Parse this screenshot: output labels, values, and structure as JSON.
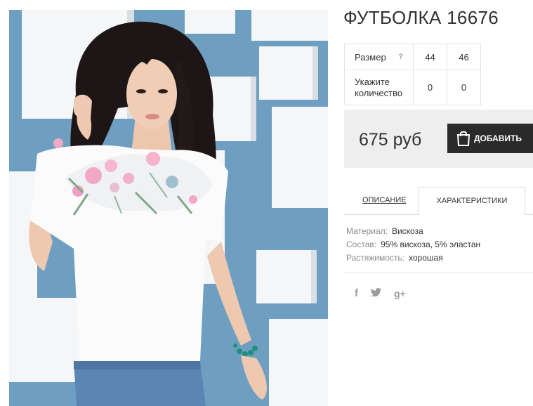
{
  "product": {
    "title": "ФУТБОЛКА 16676"
  },
  "size_table": {
    "size_label": "Размер",
    "help_icon": "?",
    "sizes": [
      "44",
      "46"
    ],
    "qty_label_line1": "Укажите",
    "qty_label_line2": "количество",
    "quantities": [
      "0",
      "0"
    ]
  },
  "purchase": {
    "price": "675 руб",
    "add_button_label": "ДОБАВИТЬ",
    "bag_icon": "shopping-bag-icon"
  },
  "tabs": {
    "description": "ОПИСАНИЕ",
    "characteristics": "ХАРАКТЕРИСТИКИ",
    "active": "characteristics"
  },
  "characteristics": [
    {
      "key": "Материал:",
      "value": "Вискоза"
    },
    {
      "key": "Состав:",
      "value": "95% вискоза, 5% эластан"
    },
    {
      "key": "Растяжимость:",
      "value": "хорошая"
    }
  ],
  "social": {
    "facebook": "f",
    "twitter": "🐦",
    "google_plus": "g+"
  },
  "colors": {
    "photo_background": "#6f9fc0",
    "button_dark": "#2a2a2a",
    "price_panel": "#eeeeee"
  }
}
